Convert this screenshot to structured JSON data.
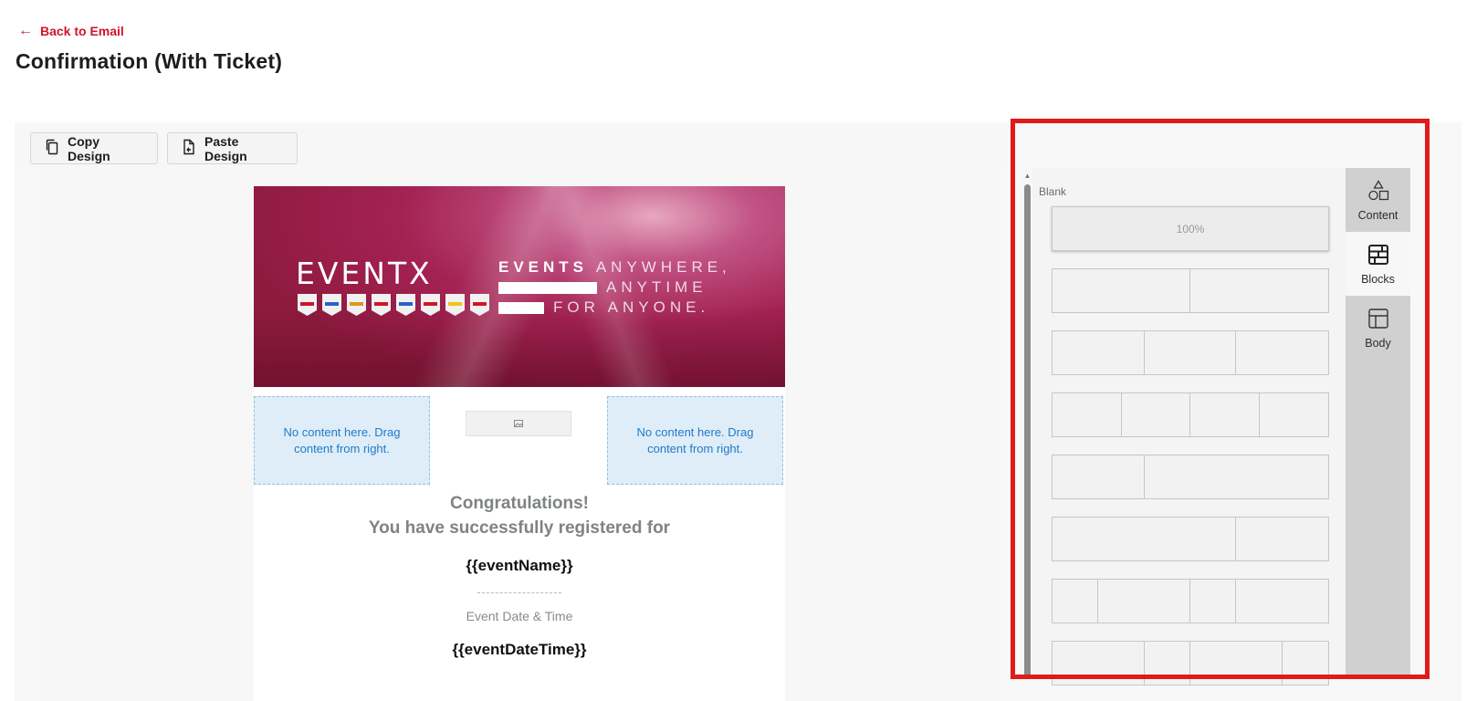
{
  "header": {
    "back_label": "Back to Email",
    "title": "Confirmation (With Ticket)"
  },
  "toolbar": {
    "copy_label": "Copy Design",
    "paste_label": "Paste Design"
  },
  "email": {
    "hero": {
      "logo_text": "EVENTX",
      "tagline_line1_bold": "EVENTS",
      "tagline_line1_rest": "ANYWHERE,",
      "tagline_line2": "ANYTIME",
      "tagline_line3": "FOR ANYONE."
    },
    "dropzone_left": "No content here. Drag content from right.",
    "dropzone_right": "No content here. Drag content from right.",
    "congrats_line1": "Congratulations!",
    "congrats_line2": "You have successfully registered for",
    "event_name_tag": "{{eventName}}",
    "date_label": "Event Date & Time",
    "event_datetime_tag": "{{eventDateTime}}"
  },
  "panel": {
    "blank_label": "Blank",
    "blank_block_text": "100%",
    "tabs": [
      {
        "label": "Content",
        "icon": "shapes-icon"
      },
      {
        "label": "Blocks",
        "icon": "blocks-grid-icon",
        "active": true
      },
      {
        "label": "Body",
        "icon": "layout-icon"
      }
    ],
    "layouts": [
      "1/2 + 1/2",
      "1/3 + 1/3 + 1/3",
      "1/4 x 4",
      "1/3 + 2/3",
      "2/3 + 1/3",
      "1/6 + 1/3 + 1/6 + 1/3",
      "1/3 + 1/6 + 1/3 + 1/6"
    ]
  },
  "colors": {
    "brand_red": "#d0142b",
    "highlight": "#e01b1b",
    "dropzone_bg": "#dfedf8",
    "dropzone_text": "#1f7ac8"
  }
}
